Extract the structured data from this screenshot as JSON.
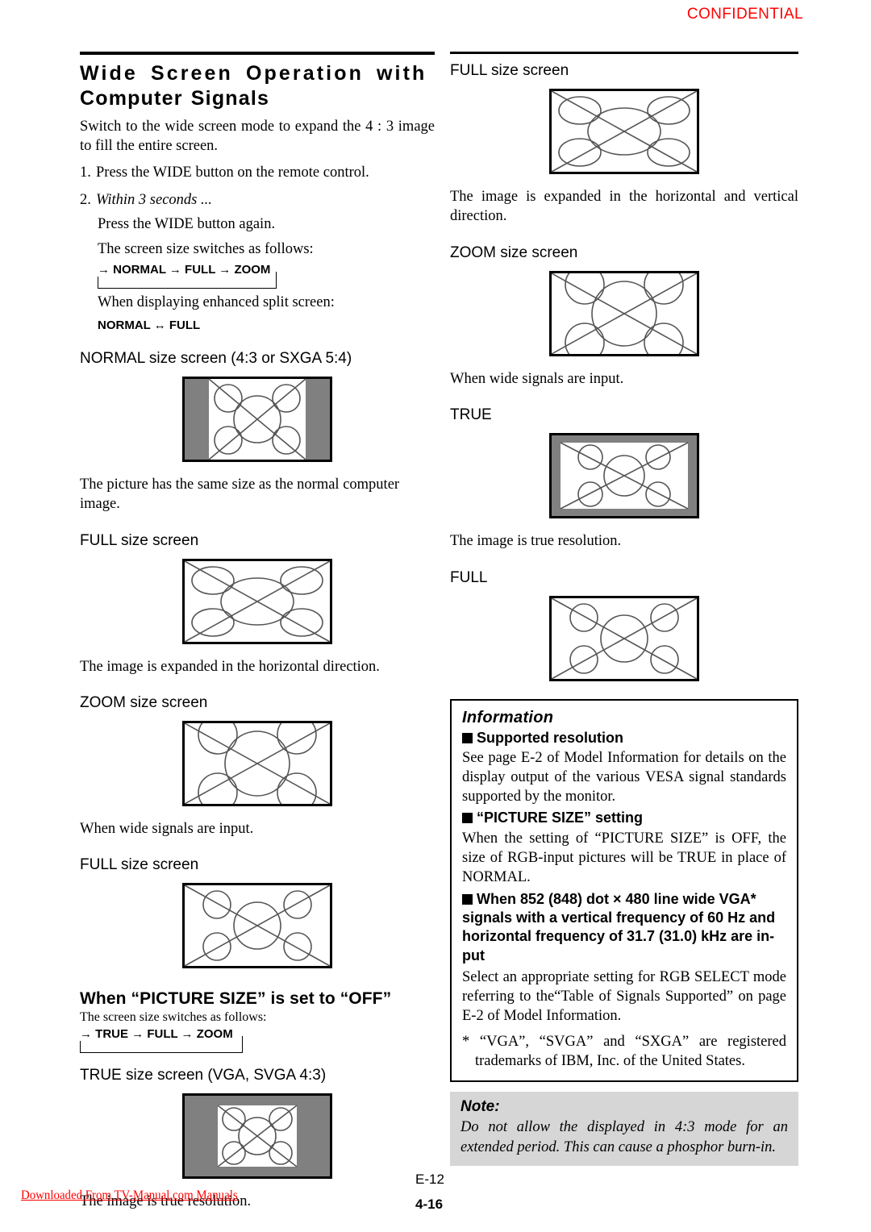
{
  "header": {
    "confidential": "CONFIDENTIAL"
  },
  "left": {
    "title_line1": "Wide  Screen  Operation  with",
    "title_line2": "Computer Signals",
    "intro": "Switch to the wide screen mode to expand the 4 : 3 image to fill the entire screen.",
    "step1_num": "1.",
    "step1": "Press the WIDE button on the remote control.",
    "step2_num": "2.",
    "step2": "Within 3 seconds ...",
    "sub1": "Press the WIDE button again.",
    "sub2": "The screen size switches as follows:",
    "flow1": "→ NORMAL → FULL → ZOOM",
    "sub3": "When displaying enhanced split screen:",
    "flow2": "NORMAL ↔  FULL",
    "cap_normal": "NORMAL size screen (4:3 or SXGA 5:4)",
    "desc_normal": "The picture has the same size as the normal computer image.",
    "cap_full": "FULL size screen",
    "desc_full": "The image is expanded in the horizontal direction.",
    "cap_zoom": "ZOOM size screen",
    "desc_zoom": "When wide signals are input.",
    "cap_full2": "FULL size screen",
    "section_heading": "When “PICTURE SIZE” is set to “OFF”",
    "section_sub": "The screen size switches as follows:",
    "flow3": "→ TRUE → FULL → ZOOM",
    "cap_true": "TRUE size screen (VGA, SVGA 4:3)",
    "desc_true": "The image is true resolution."
  },
  "right": {
    "cap_full": "FULL size screen",
    "desc_full": "The image is expanded in the horizontal and vertical direction.",
    "cap_zoom": "ZOOM size screen",
    "desc_zoom": "When wide signals are input.",
    "cap_true": "TRUE",
    "desc_true": "The image is true resolution.",
    "cap_full2": "FULL",
    "information": {
      "heading": "Information",
      "b1": "Supported resolution",
      "p1": "See page E-2 of Model Information for details on the display output of the various VESA signal standards supported by the monitor.",
      "b2": "“PICTURE SIZE” setting",
      "p2": "When the setting of “PICTURE SIZE” is OFF, the size of RGB-input pictures will be TRUE in place of NORMAL.",
      "b3": "When 852 (848) dot × 480 line wide VGA* signals with a vertical frequency of 60 Hz and horizontal frequency of 31.7 (31.0) kHz are in-put",
      "p3": "Select an appropriate setting for RGB SELECT mode referring to the“Table of Signals Supported” on page E-2 of Model Information.",
      "footnote": "* “VGA”, “SVGA” and “SXGA” are registered trademarks of IBM, Inc. of the United States."
    },
    "note": {
      "heading": "Note:",
      "text": "Do not allow the displayed in 4:3 mode for an extended period. This can cause a phosphor burn-in."
    }
  },
  "footer": {
    "download_link": "Downloaded From TV-Manual.com Manuals",
    "page_e": "E-12",
    "page_num": "4-16"
  },
  "colors": {
    "confidential": "#ff0000",
    "gray_bar": "#808080",
    "note_bg": "#d6d6d6",
    "link": "#ff0000"
  }
}
